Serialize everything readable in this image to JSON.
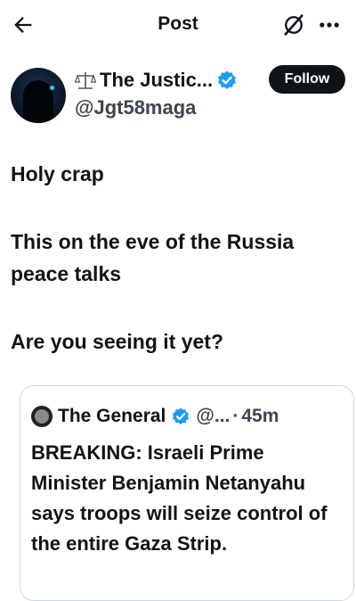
{
  "header": {
    "title": "Post",
    "back_icon": "arrow-left-icon",
    "grok_icon": "grok-icon",
    "more_icon": "more-horizontal-icon"
  },
  "author": {
    "emoji": "⚖️",
    "display_name": "The Justic...",
    "handle": "@Jgt58maga",
    "verified_icon": "verified-badge-icon",
    "verified_color": "#1d9bf0"
  },
  "follow_button": {
    "label": "Follow"
  },
  "post": {
    "lines": [
      "Holy crap",
      "This on the eve of the Russia",
      "peace talks",
      "Are you seeing it yet?"
    ]
  },
  "quote": {
    "display_name": "The General",
    "handle": "@...",
    "separator": "·",
    "time": "45m",
    "text": "BREAKING: Israeli Prime Minister Benjamin Netanyahu says troops will seize control of the entire Gaza Strip."
  },
  "colors": {
    "accent": "#1d9bf0",
    "text": "#0f1419",
    "secondary": "#3d4650",
    "border": "#cfd9de"
  }
}
